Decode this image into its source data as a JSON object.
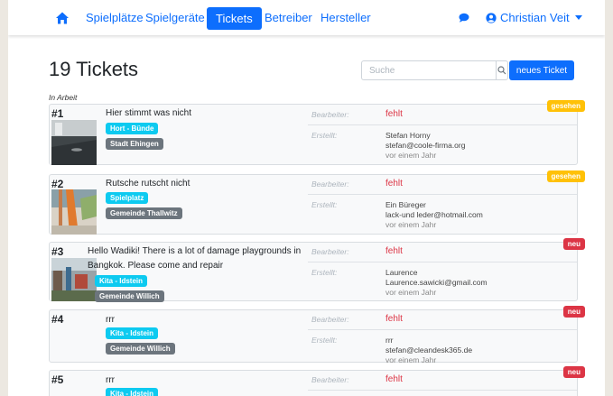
{
  "colors": {
    "primary": "#0d6efd",
    "info": "#0dcaf0",
    "secondary": "#6c757d",
    "danger": "#dc3545",
    "warning": "#ffc107"
  },
  "nav": {
    "home_icon": "home-icon",
    "items": [
      {
        "label": "Spielplätze",
        "active": false
      },
      {
        "label": "Spielgeräte",
        "active": false
      },
      {
        "label": "Tickets",
        "active": true
      },
      {
        "label": "Betreiber",
        "active": false
      },
      {
        "label": "Hersteller",
        "active": false
      }
    ],
    "chat_icon": "chat-bubble-icon",
    "user": {
      "name": "Christian Veit",
      "icon": "user-circle-icon"
    }
  },
  "page": {
    "title": "19 Tickets",
    "search_placeholder": "Suche",
    "search_icon": "search-icon",
    "new_ticket_label": "neues Ticket",
    "section_label": "In Arbeit",
    "labels": {
      "assignee": "Bearbeiter:",
      "created": "Erstellt:",
      "missing": "fehlt"
    }
  },
  "tickets": [
    {
      "id": "#1",
      "title": "Hier stimmt was nicht",
      "category": "Hort - Bünde",
      "org": "Stadt Ehingen",
      "status": "gesehen",
      "creator_name": "Stefan Horny",
      "creator_email": "stefan@coole-firma.org",
      "created": "vor einem Jahr"
    },
    {
      "id": "#2",
      "title": "Rutsche rutscht nicht",
      "category": "Spielplatz",
      "org": "Gemeinde Thallwitz",
      "status": "gesehen",
      "creator_name": "Ein Büreger",
      "creator_email": "lack-und leder@hotmail.com",
      "created": "vor einem Jahr"
    },
    {
      "id": "#3",
      "title": "Hello Wadiki! There is a lot of damage playgrounds in Bangkok. Please come and repair",
      "category": "Kita - Idstein",
      "org": "Gemeinde Willich",
      "status": "neu",
      "creator_name": "Laurence",
      "creator_email": "Laurence.sawicki@gmail.com",
      "created": "vor einem Jahr"
    },
    {
      "id": "#4",
      "title": "rrr",
      "category": "Kita - Idstein",
      "org": "Gemeinde Willich",
      "status": "neu",
      "creator_name": "rrr",
      "creator_email": "stefan@cleandesk365.de",
      "created": "vor einem Jahr"
    },
    {
      "id": "#5",
      "title": "rrr",
      "category": "Kita - Idstein",
      "status": "neu"
    }
  ]
}
